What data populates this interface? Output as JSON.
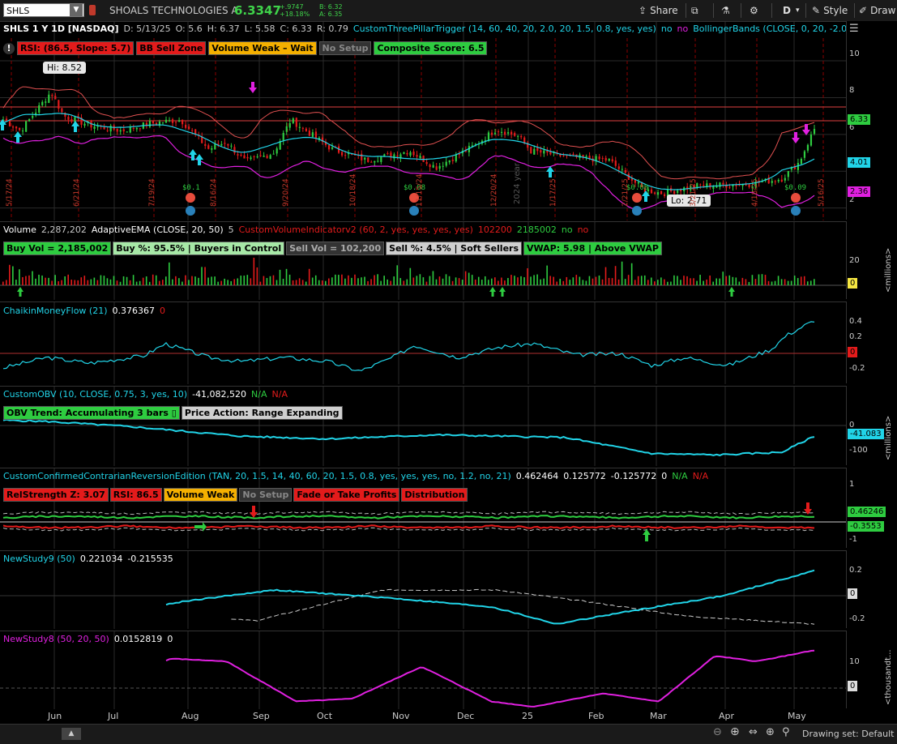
{
  "toolbar": {
    "symbol": "SHLS",
    "company": "SHOALS TECHNOLOGIES A",
    "price": "6.3347",
    "change": "+.9747",
    "change_pct": "+18.18%",
    "bid": "B: 6.32",
    "ask": "A: 6.35",
    "share": "Share",
    "period": "D",
    "style": "Style",
    "draw": "Draw"
  },
  "price_panel": {
    "title": "SHLS 1 Y 1D [NASDAQ]",
    "ohlc": [
      "D: 5/13/25",
      "O: 5.6",
      "H: 6.37",
      "L: 5.58",
      "C: 6.33",
      "R: 0.79"
    ],
    "study1": "CustomThreePillarTrigger (14, 60, 40, 20, 2.0, 20, 1.5, 0.8, yes, yes)",
    "no1": "no",
    "no2": "no",
    "study2": "BollingerBands (CLOSE, 0, 20, -2.0, 2.0,...",
    "labels": [
      "RSI: (86.5, Slope: 5.7)",
      "BB Sell Zone",
      "Volume Weak – Wait",
      "No Setup",
      "Composite Score: 6.5"
    ],
    "hi": "Hi: 8.52",
    "lo": "Lo: 2.71",
    "divs": [
      "$0.1",
      "$0.08",
      "$0.08",
      "$0.09"
    ],
    "year_label": "2024 year",
    "date_marks": [
      "5/17/24",
      "6/21/24",
      "7/19/24",
      "8/16/24",
      "9/20/24",
      "10/18/24",
      "11/15/24",
      "12/20/24",
      "1/17/25",
      "2/21/25",
      "3/21/25",
      "4/18/25",
      "5/16/25"
    ],
    "yticks": [
      "10",
      "8",
      "6",
      "4",
      "2"
    ],
    "tags": {
      "price": "6.33",
      "mid": "4.01",
      "low": "2.36"
    }
  },
  "volume_panel": {
    "header": [
      "Volume",
      "2,287,202",
      "AdaptiveEMA (CLOSE, 20, 50)",
      "5",
      "CustomVolumeIndicatorv2 (60, 2, yes, yes, yes, yes)",
      "102200",
      "2185002",
      "no",
      "no"
    ],
    "labels": [
      "Buy Vol = 2,185,002",
      "Buy %: 95.5% | Buyers in Control",
      "Sell Vol = 102,200",
      "Sell %: 4.5% | Soft Sellers",
      "VWAP: 5.98 | Above VWAP"
    ],
    "yticks": [
      "20"
    ],
    "tag": "0",
    "unit": "<millions>"
  },
  "cmf_panel": {
    "header": [
      "ChaikinMoneyFlow (21)",
      "0.376367",
      "0"
    ],
    "yticks": [
      "0.4",
      "0.2",
      "-0.2"
    ],
    "tag": "0"
  },
  "obv_panel": {
    "header": [
      "CustomOBV (10, CLOSE, 0.75, 3, yes, 10)",
      "-41,082,520",
      "N/A",
      "N/A"
    ],
    "labels": [
      "OBV Trend: Accumulating 3 bars ▯",
      "Price Action: Range Expanding"
    ],
    "yticks": [
      "0",
      "-100"
    ],
    "tag": "-41.083",
    "unit": "<millions>"
  },
  "ccr_panel": {
    "header": [
      "CustomConfirmedContrarianReversionEdition (TAN, 20, 1.5, 14, 40, 60, 20, 1.5, 0.8, yes, yes, yes, no, 1.2, no, 21)",
      "0.462464",
      "0.125772",
      "-0.125772",
      "0",
      "N/A",
      "N/A"
    ],
    "labels": [
      "RelStrength Z: 3.07",
      "RSI: 86.5",
      "Volume Weak",
      "No Setup",
      "Fade or Take Profits",
      "Distribution"
    ],
    "yticks": [
      "1",
      "-1"
    ],
    "tags": {
      "a": "0.46246",
      "b": "-0.3553"
    }
  },
  "ns9_panel": {
    "header": [
      "NewStudy9 (50)",
      "0.221034",
      "-0.215535"
    ],
    "yticks": [
      "0.2",
      "-0.2"
    ],
    "tag": "0"
  },
  "ns8_panel": {
    "header": [
      "NewStudy8 (50, 20, 50)",
      "0.0152819",
      "0"
    ],
    "yticks": [
      "10"
    ],
    "tag": "0",
    "unit": "<thousandt..."
  },
  "xaxis": [
    "Jun",
    "Jul",
    "Aug",
    "Sep",
    "Oct",
    "Nov",
    "Dec",
    "25",
    "Feb",
    "Mar",
    "Apr",
    "May"
  ],
  "status": {
    "drawing_set": "Drawing set: Default"
  },
  "colors": {
    "green": "#2ecc40",
    "red": "#e31b1b",
    "cyan": "#21d4e8",
    "magenta": "#e020e0",
    "bb": "#e05050"
  }
}
